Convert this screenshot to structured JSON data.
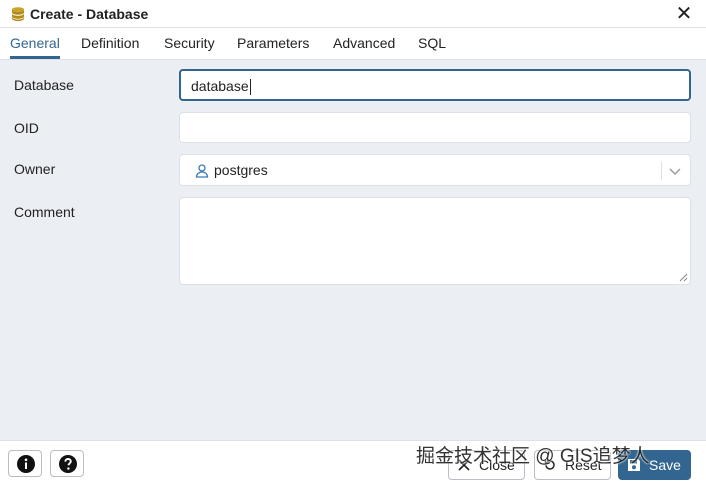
{
  "dialog": {
    "title": "Create - Database"
  },
  "tabs": [
    {
      "label": "General"
    },
    {
      "label": "Definition"
    },
    {
      "label": "Security"
    },
    {
      "label": "Parameters"
    },
    {
      "label": "Advanced"
    },
    {
      "label": "SQL"
    }
  ],
  "form": {
    "database": {
      "label": "Database",
      "value": "database"
    },
    "oid": {
      "label": "OID",
      "value": ""
    },
    "owner": {
      "label": "Owner",
      "value": "postgres"
    },
    "comment": {
      "label": "Comment",
      "value": ""
    }
  },
  "footer": {
    "info_icon": "info-icon",
    "help_icon": "help-icon",
    "close_label": "Close",
    "reset_label": "Reset",
    "save_label": "Save"
  },
  "watermark": "掘金技术社区 @ GIS追梦人",
  "colors": {
    "accent": "#326690",
    "panel": "#ebeef3",
    "border": "#dde0e6"
  }
}
